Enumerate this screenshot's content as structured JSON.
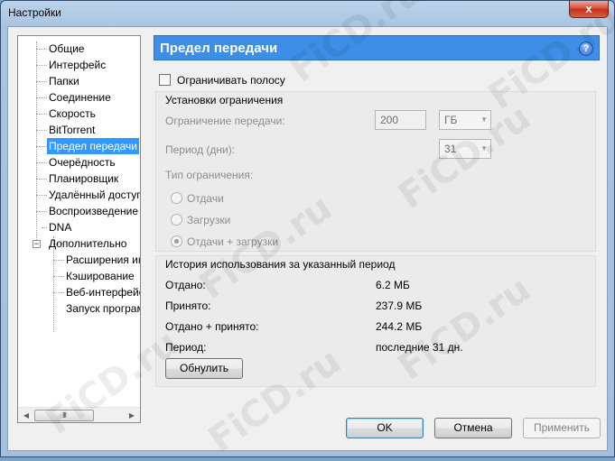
{
  "window": {
    "title": "Настройки",
    "close_glyph": "x"
  },
  "tree": {
    "items": [
      {
        "label": "Общие"
      },
      {
        "label": "Интерфейс"
      },
      {
        "label": "Папки"
      },
      {
        "label": "Соединение"
      },
      {
        "label": "Скорость"
      },
      {
        "label": "BitTorrent"
      },
      {
        "label": "Предел передачи",
        "selected": true
      },
      {
        "label": "Очерёдность"
      },
      {
        "label": "Планировщик"
      },
      {
        "label": "Удалённый доступ"
      },
      {
        "label": "Воспроизведение"
      },
      {
        "label": "DNA"
      },
      {
        "label": "Дополнительно",
        "expanded": true
      },
      {
        "label": "Расширения интерфейса",
        "child": true
      },
      {
        "label": "Кэширование",
        "child": true
      },
      {
        "label": "Веб-интерфейс",
        "child": true
      },
      {
        "label": "Запуск программ",
        "child": true
      }
    ],
    "expander_glyph": "−",
    "scroll_grip": "III"
  },
  "panel": {
    "title": "Предел передачи",
    "help_glyph": "?",
    "limit_checkbox_label": "Ограничивать полосу",
    "limit_checkbox_checked": false,
    "settings_group": {
      "title": "Установки ограничения",
      "transfer_limit_label": "Ограничение передачи:",
      "transfer_limit_value": "200",
      "transfer_unit": "ГБ",
      "period_label": "Период (дни):",
      "period_value": "31",
      "limit_type_label": "Тип ограничения:",
      "radio_upload": "Отдачи",
      "radio_download": "Загрузки",
      "radio_both": "Отдачи + загрузки",
      "selected_radio": "both"
    },
    "history_group": {
      "title": "История использования за указанный период",
      "rows": [
        {
          "label": "Отдано:",
          "value": "6.2 МБ"
        },
        {
          "label": "Принято:",
          "value": "237.9 МБ"
        },
        {
          "label": "Отдано + принято:",
          "value": "244.2 МБ"
        },
        {
          "label": "Период:",
          "value": "последние 31 дн."
        }
      ],
      "reset_button": "Обнулить"
    }
  },
  "footer": {
    "ok": "OK",
    "cancel": "Отмена",
    "apply": "Применить"
  },
  "colors": {
    "header_blue": "#3d8ee6",
    "selection_blue": "#3399ff"
  },
  "watermark": "FiCD.ru"
}
